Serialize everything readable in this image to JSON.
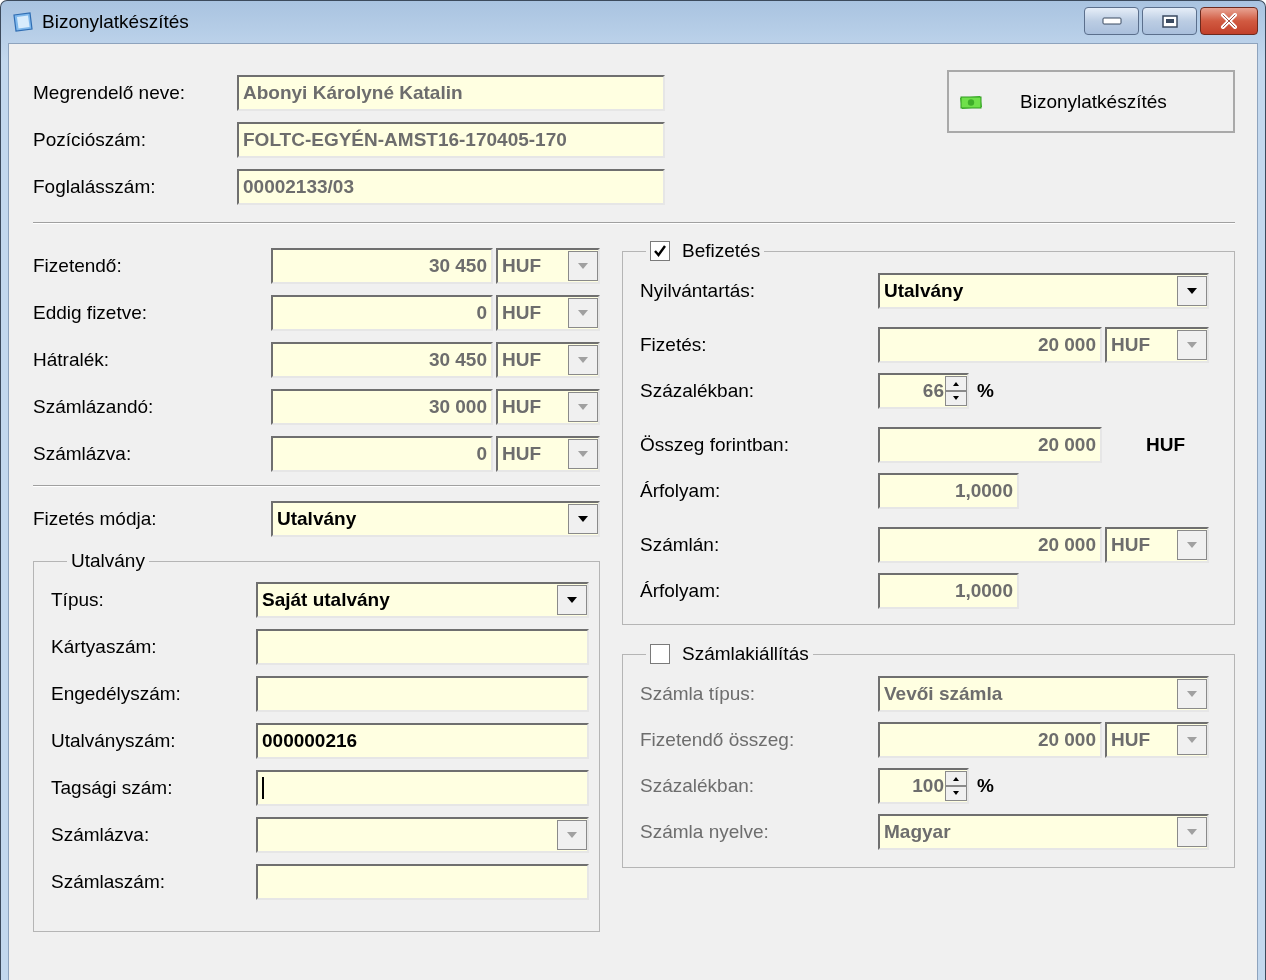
{
  "window": {
    "title": "Bizonylatkészítés"
  },
  "action_button": {
    "label": "Bizonylatkészítés"
  },
  "header": {
    "rows": [
      {
        "kind": "text",
        "label": "Megrendelő neve:",
        "value": "Abonyi Károlyné Katalin",
        "readonly": true
      },
      {
        "kind": "text",
        "label": "Pozíciószám:",
        "value": "FOLTC-EGYÉN-AMST16-170405-170",
        "readonly": true
      },
      {
        "kind": "text",
        "label": "Foglalásszám:",
        "value": "00002133/03",
        "readonly": true
      }
    ]
  },
  "amounts": {
    "rows": [
      {
        "kind": "amount",
        "label": "Fizetendő:",
        "value": "30 450",
        "currency": "HUF"
      },
      {
        "kind": "amount",
        "label": "Eddig fizetve:",
        "value": "0",
        "currency": "HUF"
      },
      {
        "kind": "amount",
        "label": "Hátralék:",
        "value": "30 450",
        "currency": "HUF"
      },
      {
        "kind": "amount",
        "label": "Számlázandó:",
        "value": "30 000",
        "currency": "HUF"
      },
      {
        "kind": "amount",
        "label": "Számlázva:",
        "value": "0",
        "currency": "HUF"
      }
    ]
  },
  "payment_method": {
    "rows": [
      {
        "kind": "combo",
        "label": "Fizetés módja:",
        "value": "Utalvány",
        "disabled": false
      }
    ]
  },
  "voucher": {
    "title": "Utalvány",
    "rows": [
      {
        "kind": "combo",
        "label": "Típus:",
        "value": "Saját utalvány",
        "disabled": false
      },
      {
        "kind": "text",
        "label": "Kártyaszám:",
        "focused": false
      },
      {
        "kind": "text",
        "label": "Engedélyszám:",
        "focused": false
      },
      {
        "kind": "text",
        "label": "Utalványszám:",
        "value": "000000216",
        "readonly": false,
        "focused": false
      },
      {
        "kind": "text",
        "label": "Tagsági szám:",
        "focused": true
      },
      {
        "kind": "combo",
        "label": "Számlázva:",
        "disabled": true
      },
      {
        "kind": "text",
        "label": "Számlaszám:",
        "focused": false
      }
    ]
  },
  "payment": {
    "title": "Befizetés",
    "checked": true,
    "row_groups": [
      [
        {
          "kind": "combo",
          "label": "Nyilvántartás:",
          "value": "Utalvány",
          "disabled": false
        }
      ],
      [
        {
          "kind": "amount",
          "label": "Fizetés:",
          "value": "20 000",
          "currency": "HUF"
        },
        {
          "kind": "spin",
          "label": "Százalékban:",
          "value": "66",
          "unit": "%"
        }
      ],
      [
        {
          "kind": "amount_unit",
          "label": "Összeg forintban:",
          "value": "20 000",
          "unit": "HUF"
        },
        {
          "kind": "rate",
          "label": "Árfolyam:",
          "value": "1,0000"
        }
      ],
      [
        {
          "kind": "amount",
          "label": "Számlán:",
          "value": "20 000",
          "currency": "HUF"
        },
        {
          "kind": "rate",
          "label": "Árfolyam:",
          "value": "1,0000"
        }
      ]
    ]
  },
  "invoice": {
    "title": "Számlakiállítás",
    "checked": false,
    "rows": [
      {
        "kind": "combo",
        "label": "Számla típus:",
        "value": "Vevői számla",
        "disabled": true
      },
      {
        "kind": "amount",
        "label": "Fizetendő összeg:",
        "value": "20 000",
        "currency": "HUF"
      },
      {
        "kind": "spin",
        "label": "Százalékban:",
        "value": "100",
        "unit": "%"
      },
      {
        "kind": "combo",
        "label": "Számla nyelve:",
        "value": "Magyar",
        "disabled": true
      }
    ]
  }
}
